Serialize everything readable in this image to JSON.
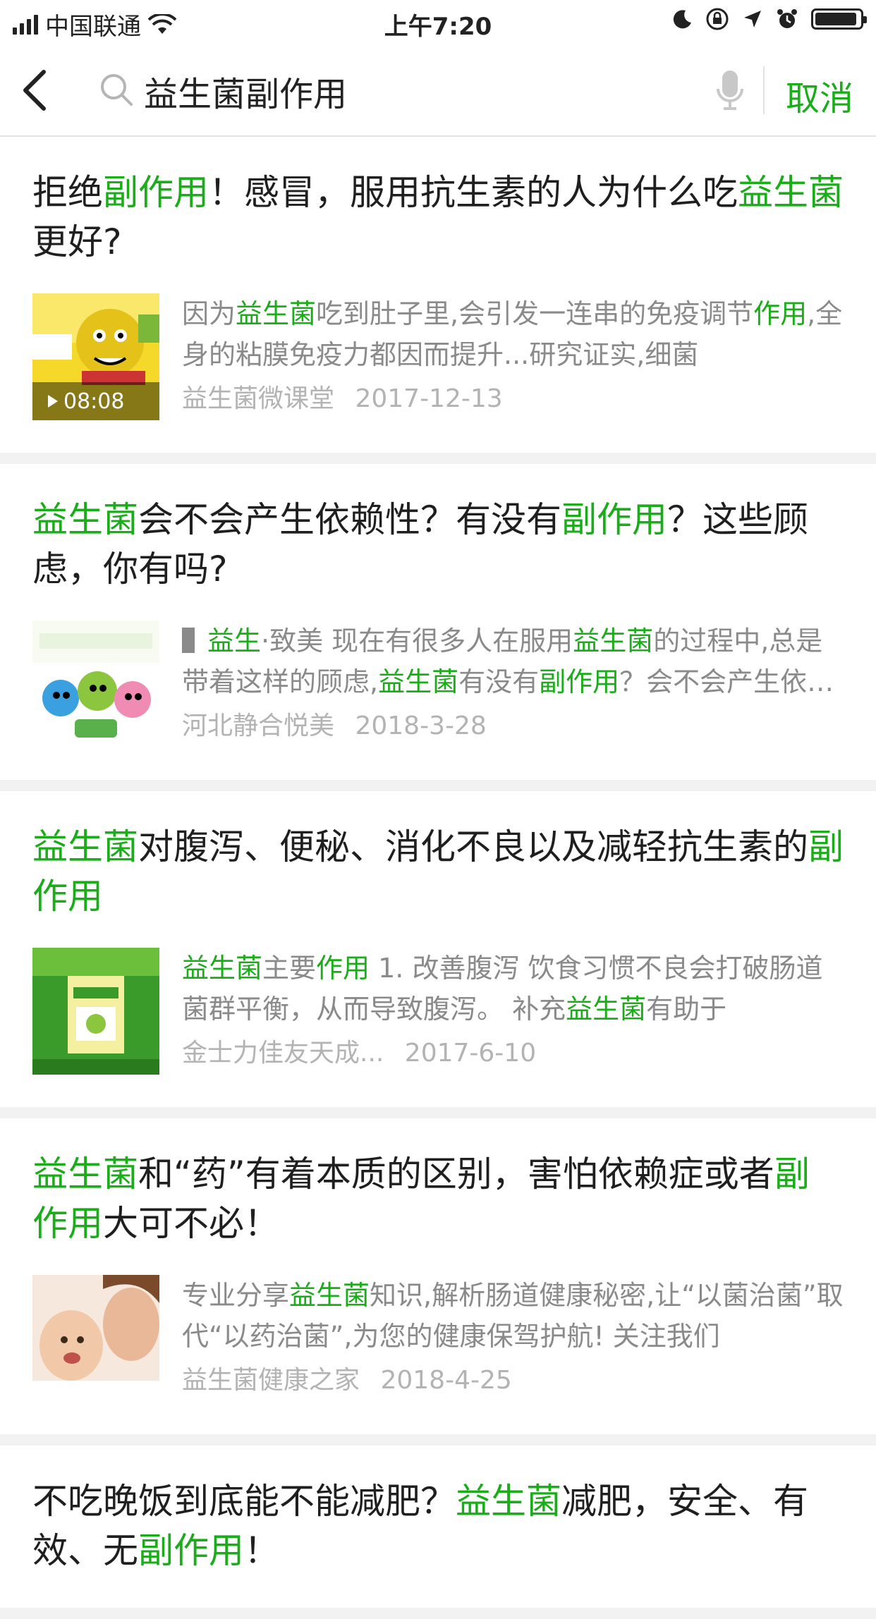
{
  "status_bar": {
    "carrier": "中国联通",
    "time": "上午7:20"
  },
  "search": {
    "query": "益生菌副作用",
    "cancel_label": "取消"
  },
  "colors": {
    "accent": "#1aad19",
    "meta": "#b3b3b3",
    "desc": "#8a8a8a"
  },
  "results": [
    {
      "title": [
        {
          "t": "拒绝",
          "h": false
        },
        {
          "t": "副作用",
          "h": true
        },
        {
          "t": "！感冒，服用抗生素的人为什么吃",
          "h": false
        },
        {
          "t": "益生菌",
          "h": true
        },
        {
          "t": "更好?",
          "h": false
        }
      ],
      "desc": [
        {
          "t": "因为",
          "h": false
        },
        {
          "t": "益生菌",
          "h": true
        },
        {
          "t": "吃到肚子里,会引发一连串的免疫调节",
          "h": false
        },
        {
          "t": "作用",
          "h": true
        },
        {
          "t": ",全身的粘膜免疫力都因而提升...研究证实,细菌",
          "h": false
        }
      ],
      "source": "益生菌微课堂",
      "date": "2017-12-13",
      "duration": "08:08",
      "thumb_icon": "cartoon-video-thumbnail"
    },
    {
      "title": [
        {
          "t": "益生菌",
          "h": true
        },
        {
          "t": "会不会产生依赖性？有没有",
          "h": false
        },
        {
          "t": "副作用",
          "h": true
        },
        {
          "t": "？这些顾虑，你有吗?",
          "h": false
        }
      ],
      "desc": [
        {
          "t": "益生",
          "h": true
        },
        {
          "t": "·致美 现在有很多人在服用",
          "h": false
        },
        {
          "t": "益生菌",
          "h": true
        },
        {
          "t": "的过程中,总是带着这样的顾虑,",
          "h": false
        },
        {
          "t": "益生菌",
          "h": true
        },
        {
          "t": "有没有",
          "h": false
        },
        {
          "t": "副作用",
          "h": true
        },
        {
          "t": "？会不会产生依赖性",
          "h": false
        }
      ],
      "source": "河北静合悦美",
      "date": "2018-3-28",
      "thumb_icon": "probiotic-cartoon-thumbnail"
    },
    {
      "title": [
        {
          "t": "益生菌",
          "h": true
        },
        {
          "t": "对腹泻、便秘、消化不良以及减轻抗生素的",
          "h": false
        },
        {
          "t": "副作用",
          "h": true
        }
      ],
      "desc": [
        {
          "t": "益生菌",
          "h": true
        },
        {
          "t": "主要",
          "h": false
        },
        {
          "t": "作用",
          "h": true
        },
        {
          "t": " 1. 改善腹泻 饮食习惯不良会打破肠道菌群平衡，从而导致腹泻。 补充",
          "h": false
        },
        {
          "t": "益生菌",
          "h": true
        },
        {
          "t": "有助于",
          "h": false
        }
      ],
      "source": "金士力佳友天成...",
      "date": "2017-6-10",
      "thumb_icon": "probiotic-product-thumbnail"
    },
    {
      "title": [
        {
          "t": "益生菌",
          "h": true
        },
        {
          "t": "和“药”有着本质的区别，害怕依赖症或者",
          "h": false
        },
        {
          "t": "副作用",
          "h": true
        },
        {
          "t": "大可不必！",
          "h": false
        }
      ],
      "desc": [
        {
          "t": "专业分享",
          "h": false
        },
        {
          "t": "益生菌",
          "h": true
        },
        {
          "t": "知识,解析肠道健康秘密,让“以菌治菌”取代“以药治菌”,为您的健康保驾护航! 关注我们",
          "h": false
        }
      ],
      "source": "益生菌健康之家",
      "date": "2018-4-25",
      "thumb_icon": "mother-baby-photo-thumbnail"
    },
    {
      "title": [
        {
          "t": "不吃晚饭到底能不能减肥？",
          "h": false
        },
        {
          "t": "益生菌",
          "h": true
        },
        {
          "t": "减肥，安全、有效、无",
          "h": false
        },
        {
          "t": "副作用",
          "h": true
        },
        {
          "t": "！",
          "h": false
        }
      ]
    }
  ]
}
